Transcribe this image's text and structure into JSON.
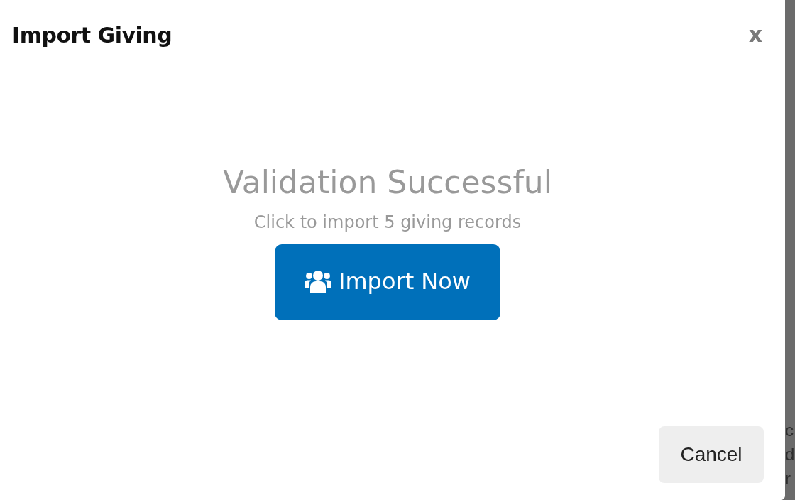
{
  "dialog": {
    "title": "Import Giving",
    "close_label": "x"
  },
  "status": {
    "heading": "Validation Successful",
    "message": "Click to import 5 giving records"
  },
  "primary_button": {
    "label": "Import Now"
  },
  "footer_buttons": [
    {
      "label": "Cancel"
    }
  ],
  "backdrop": {
    "fragments": [
      "c",
      "d",
      "r"
    ]
  }
}
